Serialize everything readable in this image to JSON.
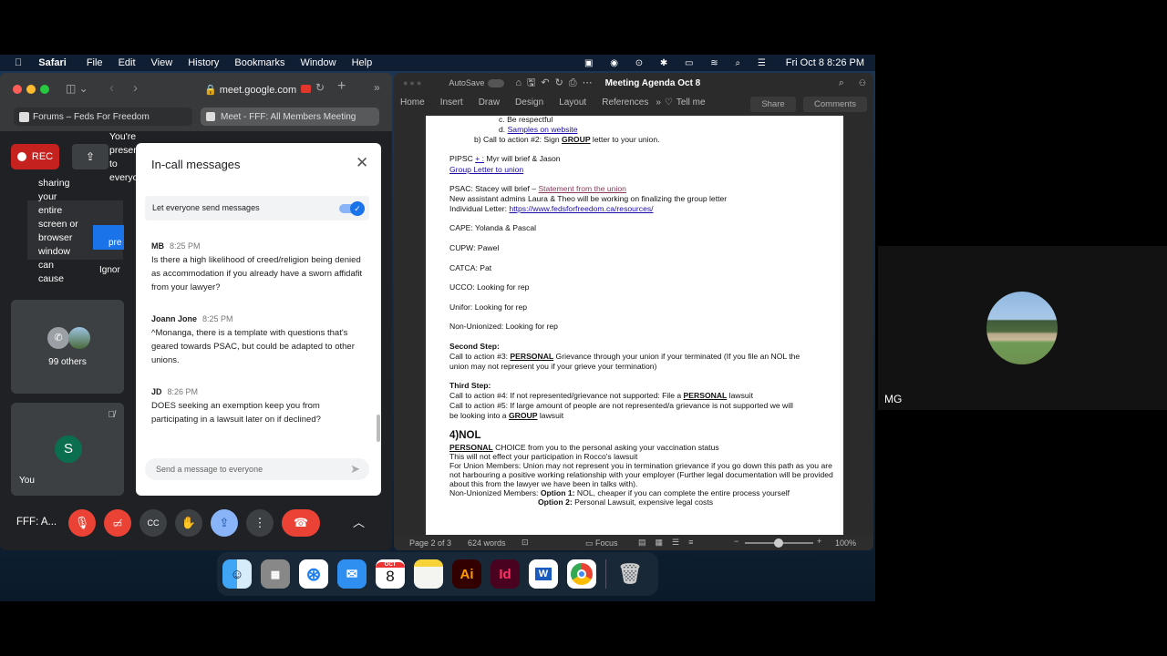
{
  "menubar": {
    "app": "Safari",
    "items": [
      "File",
      "Edit",
      "View",
      "History",
      "Bookmarks",
      "Window",
      "Help"
    ],
    "clock": "Fri Oct 8  8:26 PM"
  },
  "safari": {
    "url": "meet.google.com",
    "tabs": [
      {
        "label": "Forums – Feds For Freedom"
      },
      {
        "label": "Meet - FFF: All Members Meeting"
      }
    ]
  },
  "meet": {
    "rec_label": "REC",
    "presenting_text": "You're presenting to everyone",
    "sharing_text": "sharing your entire screen or browser window can cause",
    "present_btn": "pre",
    "ignore_btn": "Ignor",
    "others_label": "99 others",
    "you_initial": "S",
    "you_label": "You",
    "meeting_name": "FFF: A...",
    "chat": {
      "title": "In-call messages",
      "toggle_label": "Let everyone send messages",
      "toggle_on": true,
      "messages": [
        {
          "sender": "MB",
          "time": "8:25 PM",
          "text": "Is there a high likelihood of creed/religion being denied as accommodation if you already have a sworn affidafit from your lawyer?"
        },
        {
          "sender": "Joann Jone",
          "time": "8:25 PM",
          "text": "^Monanga, there is a template with questions that's geared towards PSAC, but could be adapted to other unions."
        },
        {
          "sender": "JD",
          "time": "8:26 PM",
          "text": "DOES seeking an exemption keep you from participating in a lawsuit later on if declined?"
        }
      ],
      "input_placeholder": "Send a message to everyone"
    },
    "colors": {
      "red": "#ea4335",
      "blue": "#8ab4f8",
      "green": "#0b6e4f"
    }
  },
  "word": {
    "autosave": "AutoSave",
    "autosave_state": "off",
    "title": "Meeting Agenda Oct 8",
    "ribbon": [
      "Home",
      "Insert",
      "Draw",
      "Design",
      "Layout",
      "References"
    ],
    "tell_me": "Tell me",
    "share": "Share",
    "comments": "Comments",
    "status": {
      "page": "Page 2 of 3",
      "words": "624 words",
      "focus": "Focus",
      "zoom": "100%",
      "zoom_level": 100
    },
    "doc_lines": [
      [
        {
          "t": "c.   Be respectful"
        }
      ],
      [
        {
          "t": "d.   "
        },
        {
          "t": "Samples on website",
          "c": "lnk"
        }
      ],
      [
        {
          "t": "b)  Call to action #2: Sign "
        },
        {
          "t": "GROUP",
          "c": "b u"
        },
        {
          "t": " letter to your union."
        }
      ],
      [
        {
          "t": "PIPSC "
        },
        {
          "t": "+ :",
          "c": "lnk"
        },
        {
          "t": " Myr will brief & Jason"
        }
      ],
      [
        {
          "t": "Group Letter to union",
          "c": "lnk"
        }
      ],
      [
        {
          "t": "PSAC: Stacey will brief – "
        },
        {
          "t": "Statement from the union",
          "c": "lnk2"
        }
      ],
      [
        {
          "t": "New assistant admins Laura & Theo will be working on finalizing the group letter"
        }
      ],
      [
        {
          "t": "Individual Letter: "
        },
        {
          "t": "https://www.fedsforfreedom.ca/resources/",
          "c": "lnk"
        }
      ],
      [
        {
          "t": "CAPE: Yolanda & Pascal"
        }
      ],
      [
        {
          "t": "CUPW: Pawel"
        }
      ],
      [
        {
          "t": "CATCA: Pat"
        }
      ],
      [
        {
          "t": "UCCO: Looking for rep"
        }
      ],
      [
        {
          "t": "Unifor: Looking for rep"
        }
      ],
      [
        {
          "t": "Non-Unionized: Looking for rep"
        }
      ],
      [
        {
          "t": "Second Step:",
          "c": "b"
        }
      ],
      [
        {
          "t": "Call to action #3: "
        },
        {
          "t": "PERSONAL",
          "c": "b u"
        },
        {
          "t": " Grievance through your union if your terminated (If you file an NOL the"
        }
      ],
      [
        {
          "t": "union may not represent you if your grieve your termination)"
        }
      ],
      [
        {
          "t": "Third Step:",
          "c": "b"
        }
      ],
      [
        {
          "t": "Call to action #4: If not represented/grievance not supported: File a "
        },
        {
          "t": "PERSONAL",
          "c": "b u"
        },
        {
          "t": " lawsuit"
        }
      ],
      [
        {
          "t": "Call to action #5: If large amount of people are not represented/a grievance is not supported we will"
        }
      ],
      [
        {
          "t": "be looking into a "
        },
        {
          "t": "GROUP",
          "c": "b u"
        },
        {
          "t": " lawsuit"
        }
      ],
      [
        {
          "t": "4)NOL",
          "c": "h"
        }
      ],
      [
        {
          "t": "PERSONAL",
          "c": "b u"
        },
        {
          "t": " CHOICE from you to the personal asking your vaccination status"
        }
      ],
      [
        {
          "t": "This will not effect your participation in Rocco's lawsuit"
        }
      ],
      [
        {
          "t": "For Union Members: Union may not represent you in termination grievance if you go down this path as you are"
        }
      ],
      [
        {
          "t": "not harbouring a positive working relationship with your employer (Further legal documentation will be provided"
        }
      ],
      [
        {
          "t": "about this from the lawyer we have been in talks with)."
        }
      ],
      [
        {
          "t": "Non-Unionized Members: "
        },
        {
          "t": "Option 1:",
          "c": "b"
        },
        {
          "t": " NOL, cheaper if you can complete the entire process yourself"
        }
      ],
      [
        {
          "t": "Option 2:",
          "c": "b"
        },
        {
          "t": " Personal Lawsuit, expensive legal costs"
        }
      ]
    ]
  },
  "participant": {
    "name": "MG"
  },
  "dock": {
    "calendar_month": "OCT",
    "calendar_day": "8",
    "apps": [
      "finder",
      "launchpad",
      "safari",
      "mail",
      "calendar",
      "notes",
      "illustrator",
      "indesign",
      "word",
      "chrome",
      "trash"
    ],
    "ai": "Ai",
    "id": "Id",
    "w": "W"
  }
}
